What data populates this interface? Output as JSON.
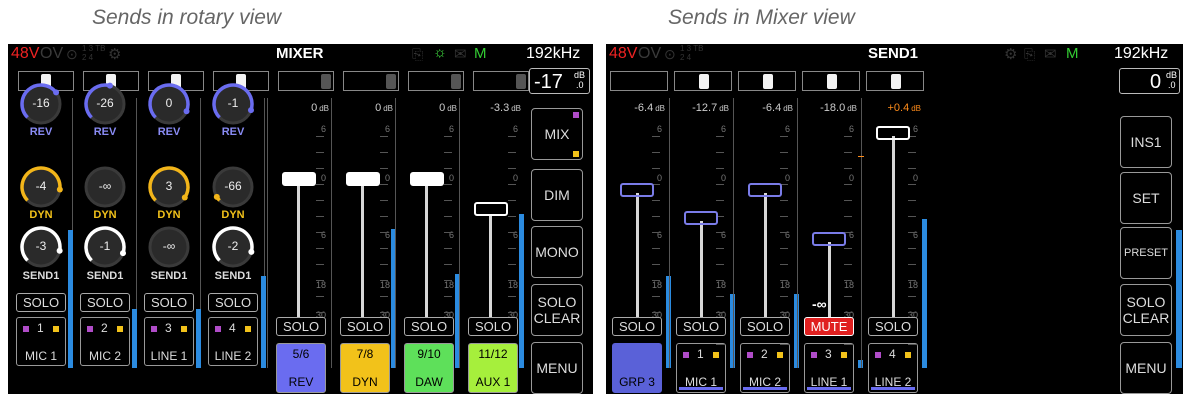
{
  "captions": {
    "left": "Sends in rotary view",
    "right": "Sends in Mixer view"
  },
  "left": {
    "topbar": {
      "phantom": "48V",
      "ov": "OV",
      "tiny": "1 3 TB\n2 4",
      "title": "MIXER",
      "m": "M",
      "rate": "192kHz"
    },
    "main_level": {
      "value": "-17",
      "unit": "dB",
      "unit2": ".0"
    },
    "channels": [
      {
        "rev": "-16",
        "dyn": "-4",
        "send": "-3",
        "solo": "SOLO",
        "num": "1",
        "name": "MIC 1"
      },
      {
        "rev": "-26",
        "dyn": "-∞",
        "send": "-1",
        "solo": "SOLO",
        "num": "2",
        "name": "MIC 2"
      },
      {
        "rev": "0",
        "dyn": "3",
        "send": "-∞",
        "solo": "SOLO",
        "num": "3",
        "name": "LINE 1"
      },
      {
        "rev": "-1",
        "dyn": "-66",
        "send": "-2",
        "solo": "SOLO",
        "num": "4",
        "name": "LINE 2"
      }
    ],
    "knob_labels": {
      "rev": "REV",
      "dyn": "DYN",
      "send": "SEND1"
    },
    "faders": [
      {
        "db": "0",
        "unit": "dB",
        "solo": "SOLO",
        "num": "5/6",
        "name": "REV",
        "color": "#6a6cf0"
      },
      {
        "db": "0",
        "unit": "dB",
        "solo": "SOLO",
        "num": "7/8",
        "name": "DYN",
        "color": "#f2c21a"
      },
      {
        "db": "0",
        "unit": "dB",
        "solo": "SOLO",
        "num": "9/10",
        "name": "DAW",
        "color": "#5ee05a"
      },
      {
        "db": "-3.3",
        "unit": "dB",
        "solo": "SOLO",
        "num": "11/12",
        "name": "AUX 1",
        "color": "#a6ef3c"
      }
    ],
    "scale": [
      "6",
      "0",
      "6",
      "18",
      "30"
    ],
    "right_buttons": [
      "MIX",
      "DIM",
      "MONO",
      "SOLO\nCLEAR",
      "MENU"
    ]
  },
  "right": {
    "topbar": {
      "phantom": "48V",
      "ov": "OV",
      "tiny": "1 3 TB\n2 4",
      "title": "SEND1",
      "m": "M",
      "rate": "192kHz"
    },
    "main_level": {
      "value": "0",
      "unit": "dB",
      "unit2": ".0"
    },
    "faders": [
      {
        "db": "-6.4",
        "unit": "dB",
        "solo": "SOLO",
        "name": "GRP 3"
      },
      {
        "db": "-12.7",
        "unit": "dB",
        "solo": "SOLO",
        "num": "1",
        "name": "MIC 1"
      },
      {
        "db": "-6.4",
        "unit": "dB",
        "solo": "SOLO",
        "num": "2",
        "name": "MIC 2"
      },
      {
        "db": "-18.0",
        "unit": "dB",
        "solo": "MUTE",
        "num": "3",
        "name": "LINE 1",
        "inf": "-∞"
      },
      {
        "db": "+0.4",
        "unit": "dB",
        "solo": "SOLO",
        "num": "4",
        "name": "LINE 2"
      }
    ],
    "scale": [
      "6",
      "0",
      "6",
      "18",
      "30"
    ],
    "right_buttons": [
      "INS1",
      "SET",
      "PRESET",
      "SOLO\nCLEAR",
      "MENU"
    ]
  },
  "colors": {
    "rev_knob": "#6a6cf0",
    "dyn_knob": "#f2b51a",
    "send_knob": "#ffffff",
    "mute": "#e02020",
    "meter": "#2b8be0",
    "plus": "#ff8c1a"
  }
}
